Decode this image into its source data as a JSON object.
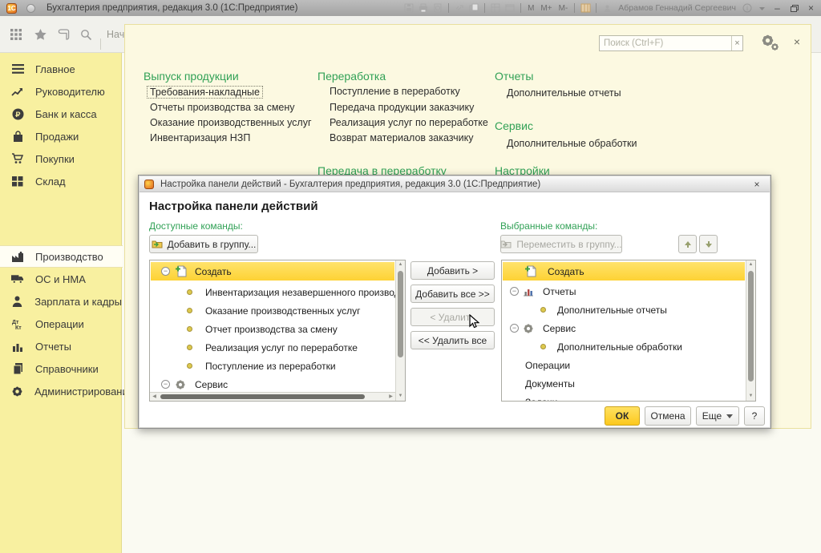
{
  "titlebar": {
    "title": "Бухгалтерия предприятия, редакция 3.0  (1С:Предприятие)",
    "user": "Абрамов Геннадий Сергеевич",
    "mem": [
      "M",
      "M+",
      "M-"
    ],
    "icons": [
      "save-icon",
      "print-icon",
      "print-preview-icon",
      "link-icon",
      "copy-icon",
      "table-icon",
      "window-icon",
      "columns-icon",
      "user-icon",
      "info-icon",
      "chevron-down-icon",
      "minimize-icon",
      "restore-icon",
      "close-icon"
    ],
    "minimize_glyph": "–",
    "close_glyph": "×"
  },
  "toolbar": {
    "tab": "Нач",
    "icons": [
      "apps-grid-icon",
      "star-icon",
      "history-icon",
      "search-icon"
    ]
  },
  "sidebar": {
    "items": [
      {
        "label": "Главное",
        "icon": "menu-lines-icon"
      },
      {
        "label": "Руководителю",
        "icon": "trend-chart-icon"
      },
      {
        "label": "Банк и касса",
        "icon": "ruble-icon"
      },
      {
        "label": "Продажи",
        "icon": "bag-icon"
      },
      {
        "label": "Покупки",
        "icon": "cart-icon"
      },
      {
        "label": "Склад",
        "icon": "warehouse-icon"
      },
      {
        "label": "Производство",
        "icon": "factory-icon",
        "selected": true
      },
      {
        "label": "ОС и НМА",
        "icon": "truck-icon"
      },
      {
        "label": "Зарплата и кадры",
        "icon": "person-icon"
      },
      {
        "label": "Операции",
        "icon": "dt-kt-icon"
      },
      {
        "label": "Отчеты",
        "icon": "bar-chart-icon"
      },
      {
        "label": "Справочники",
        "icon": "book-icon"
      },
      {
        "label": "Администрирование",
        "icon": "gear-icon"
      }
    ]
  },
  "panel": {
    "search_placeholder": "Поиск (Ctrl+F)",
    "col1": {
      "title": "Выпуск продукции",
      "items": [
        "Требования-накладные",
        "Отчеты производства за смену",
        "Оказание производственных услуг",
        "Инвентаризация НЗП"
      ]
    },
    "col2": {
      "title": "Переработка",
      "items": [
        "Поступление в переработку",
        "Передача продукции заказчику",
        "Реализация услуг по переработке",
        "Возврат материалов заказчику"
      ],
      "title2": "Передача в переработку"
    },
    "col3": {
      "title": "Отчеты",
      "items": [
        "Дополнительные отчеты"
      ],
      "title2": "Сервис",
      "items2": [
        "Дополнительные обработки"
      ],
      "title3": "Настройки"
    }
  },
  "dialog": {
    "title": "Настройка панели действий - Бухгалтерия предприятия, редакция 3.0  (1С:Предприятие)",
    "heading": "Настройка панели действий",
    "available_label": "Доступные команды:",
    "selected_label": "Выбранные команды:",
    "add_to_group_btn": "Добавить в группу...",
    "move_to_group_btn": "Переместить в группу...",
    "transfer": {
      "add": "Добавить >",
      "add_all": "Добавить все >>",
      "remove": "< Удалить",
      "remove_all": "<< Удалить все"
    },
    "available": [
      {
        "label": "Создать",
        "icon": "new-document-icon",
        "type": "group",
        "selected": true
      },
      {
        "label": "Инвентаризация незавершенного производства",
        "icon": "bullet-icon",
        "type": "item"
      },
      {
        "label": "Оказание производственных услуг",
        "icon": "bullet-icon",
        "type": "item"
      },
      {
        "label": "Отчет производства за смену",
        "icon": "bullet-icon",
        "type": "item"
      },
      {
        "label": "Реализация услуг по переработке",
        "icon": "bullet-icon",
        "type": "item"
      },
      {
        "label": "Поступление из переработки",
        "icon": "bullet-icon",
        "type": "item"
      },
      {
        "label": "Сервис",
        "icon": "gear-icon",
        "type": "group"
      }
    ],
    "selected": [
      {
        "label": "Создать",
        "icon": "new-document-icon",
        "type": "group",
        "selected": true
      },
      {
        "label": "Отчеты",
        "icon": "report-chart-icon",
        "type": "group"
      },
      {
        "label": "Дополнительные отчеты",
        "icon": "bullet-icon",
        "type": "item"
      },
      {
        "label": "Сервис",
        "icon": "gear-icon",
        "type": "group"
      },
      {
        "label": "Дополнительные обработки",
        "icon": "bullet-icon",
        "type": "item"
      },
      {
        "label": "Операции",
        "type": "plain"
      },
      {
        "label": "Документы",
        "type": "plain"
      },
      {
        "label": "Задачи",
        "type": "plain"
      }
    ],
    "footer": {
      "ok": "ОК",
      "cancel": "Отмена",
      "more": "Еще",
      "help": "?"
    }
  }
}
